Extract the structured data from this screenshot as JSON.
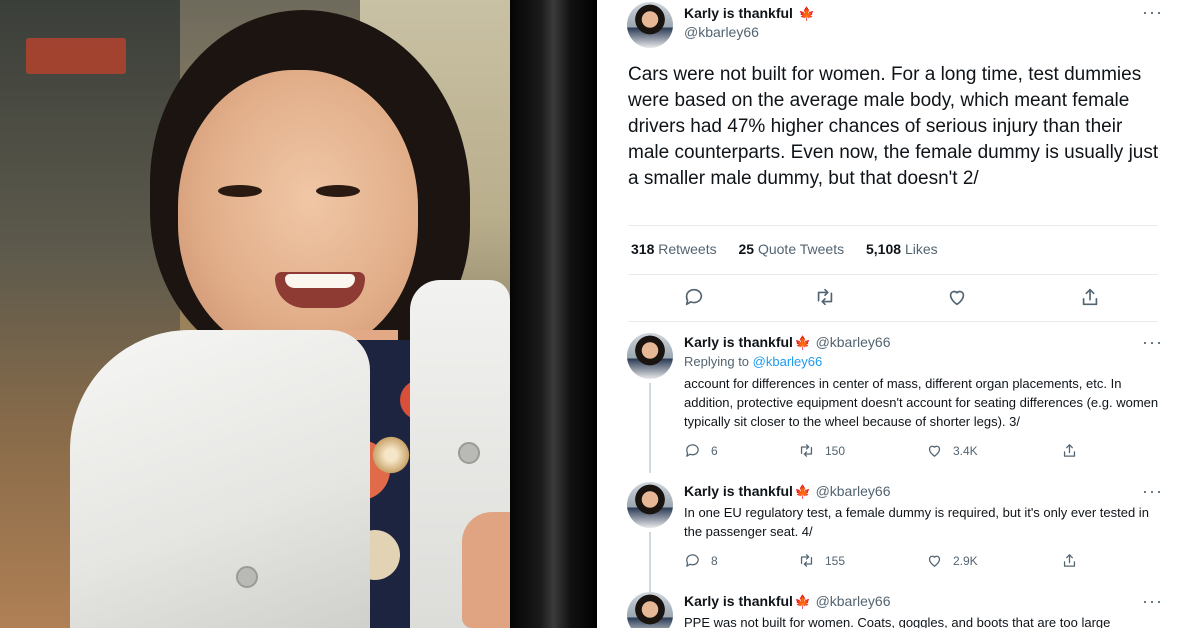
{
  "photo": {
    "alt": ""
  },
  "tweet": {
    "author_name": "Karly is thankful",
    "flag_icon": "maple-leaf-icon",
    "handle": "@kbarley66",
    "text": "Cars were not built for women. For a long time, test dummies were based on the average male body, which meant female drivers had 47% higher chances of serious injury than their male counterparts. Even now, the female dummy is usually just a smaller male dummy, but that doesn't 2/",
    "stats": {
      "retweets_count": "318",
      "retweets_label": "Retweets",
      "quotes_count": "25",
      "quotes_label": "Quote Tweets",
      "likes_count": "5,108",
      "likes_label": "Likes"
    },
    "more_label": "···"
  },
  "replies": [
    {
      "author_name": "Karly is thankful",
      "handle": "@kbarley66",
      "replying_prefix": "Replying to",
      "replying_to": "@kbarley66",
      "text": "account for differences in center of mass, different organ placements, etc. In addition, protective equipment doesn't account for seating differences (e.g. women typically sit closer to the wheel because of shorter legs). 3/",
      "replies_count": "6",
      "retweets_count": "150",
      "likes_count": "3.4K"
    },
    {
      "author_name": "Karly is thankful",
      "handle": "@kbarley66",
      "text": "In one EU regulatory test, a female dummy is required, but it's only ever tested in the passenger seat. 4/",
      "replies_count": "8",
      "retweets_count": "155",
      "likes_count": "2.9K"
    },
    {
      "author_name": "Karly is thankful",
      "handle": "@kbarley66",
      "text": "PPE was not built for women. Coats, goggles, and boots that are too large"
    }
  ],
  "colors": {
    "text": "#0f1419",
    "secondary": "#536471",
    "link": "#1d9bf0",
    "flag": "#d8202a",
    "divider": "#e6ecf0"
  }
}
